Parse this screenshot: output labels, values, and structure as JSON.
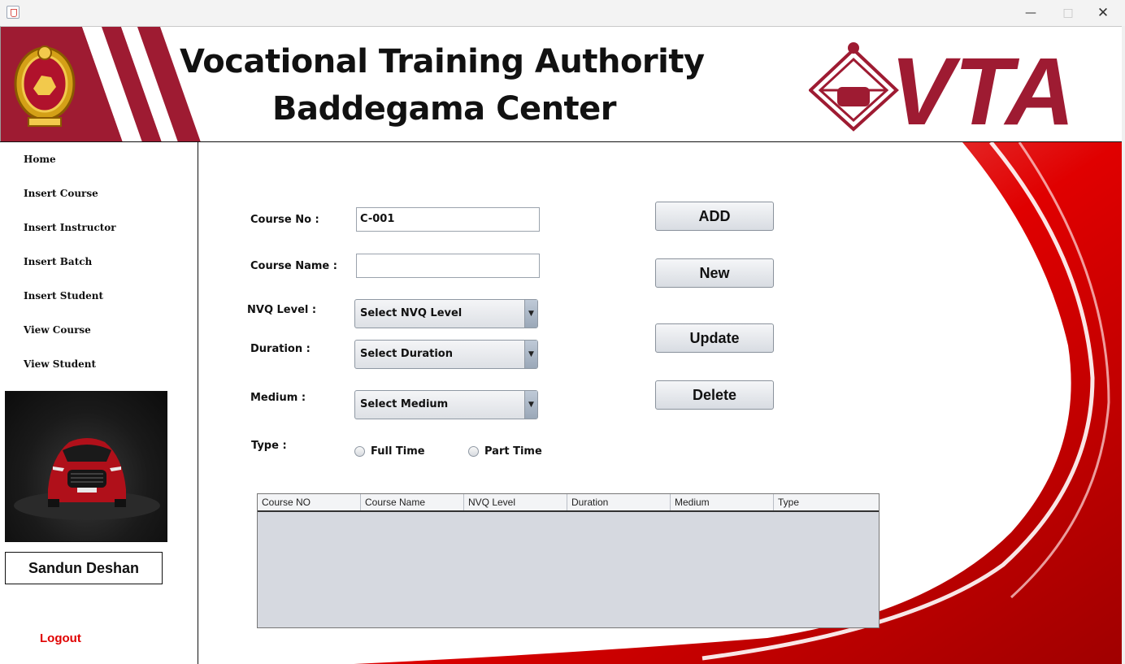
{
  "window": {
    "minimize": "—",
    "maximize": "□",
    "close": "✕"
  },
  "header": {
    "title_line1": "Vocational Training Authority",
    "title_line2": "Baddegama Center",
    "logo_text": "VTA"
  },
  "sidebar": {
    "items": [
      {
        "label": "Home"
      },
      {
        "label": "Insert Course"
      },
      {
        "label": "Insert Instructor"
      },
      {
        "label": "Insert Batch"
      },
      {
        "label": "Insert Student"
      },
      {
        "label": "View Course"
      },
      {
        "label": "View Student"
      }
    ],
    "user_name": "Sandun Deshan",
    "logout_label": "Logout"
  },
  "form": {
    "course_no_label": "Course No :",
    "course_no_value": "C-001",
    "course_name_label": "Course Name :",
    "course_name_value": "",
    "nvq_label": "NVQ Level :",
    "nvq_selected": "Select NVQ Level",
    "duration_label": "Duration :",
    "duration_selected": "Select Duration",
    "medium_label": "Medium :",
    "medium_selected": "Select Medium",
    "type_label": "Type :",
    "type_options": [
      "Full Time",
      "Part Time"
    ]
  },
  "buttons": {
    "add": "ADD",
    "new": "New",
    "update": "Update",
    "delete": "Delete"
  },
  "table": {
    "columns": [
      "Course NO",
      "Course Name",
      "NVQ Level",
      "Duration",
      "Medium",
      "Type"
    ],
    "rows": []
  },
  "colors": {
    "brand_red": "#9e1b32",
    "accent_red": "#e00000"
  }
}
